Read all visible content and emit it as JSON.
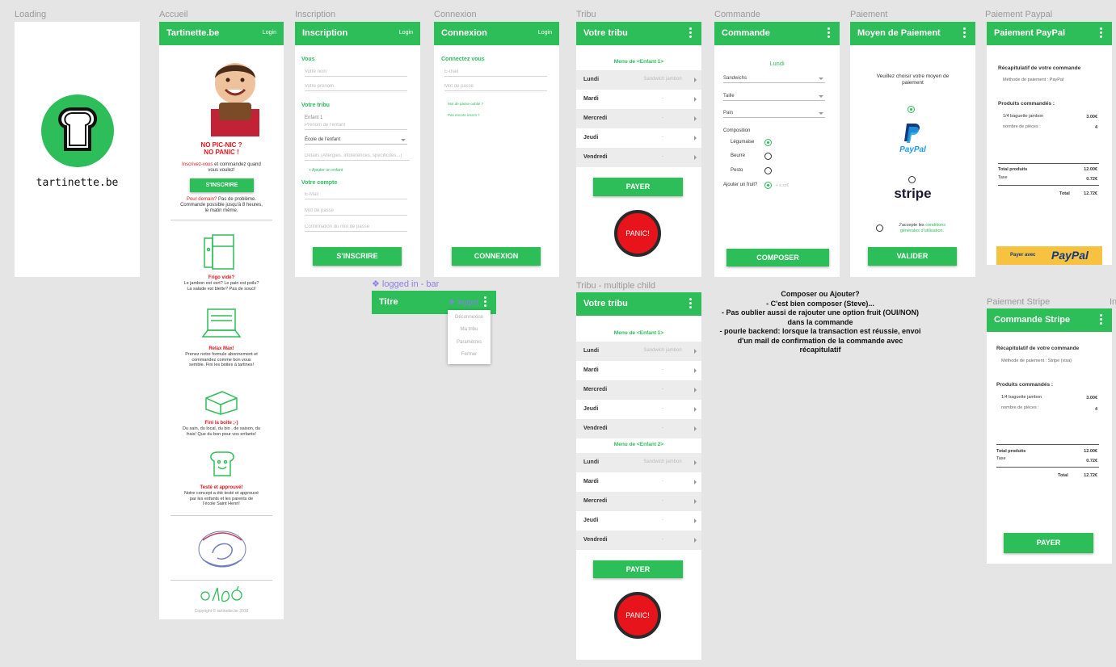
{
  "frame_labels": {
    "loading": "Loading",
    "accueil": "Accueil",
    "inscription": "Inscription",
    "connexion": "Connexion",
    "tribu": "Tribu",
    "commande": "Commande",
    "paiement": "Paiement",
    "paiement_paypal": "Paiement Paypal",
    "tribu_multi": "Tribu - multiple child",
    "paiement_stripe": "Paiement Stripe",
    "logged_in_bar": "❖ logged in - bar",
    "cut_off": "In"
  },
  "loading": {
    "brand": "tartinette.be"
  },
  "accueil": {
    "title": "Tartinette.be",
    "login": "Login",
    "headline1": "NO PIC-NIC ?",
    "headline2": "NO PANIC !",
    "cta_text_link": "Inscrivez-vous",
    "cta_text_rest": " et commandez quand",
    "cta_text2": "vous voulez!",
    "signup_button": "S'INSCRIRE",
    "tomorrow_red": "Pour demain?",
    "tomorrow_rest": " Pas de problème.",
    "tomorrow2": "Commande possible jusqu'à 8 heures,",
    "tomorrow3": "le matin même.",
    "features": [
      {
        "title": "Frigo vide?",
        "l1": "Le jambon est vert? Le pain est poilu?",
        "l2": "La salade est blette? Pas de souci!",
        "l3": ""
      },
      {
        "title": "Relax Max!",
        "l1": "Prenez notre formule abonnement et",
        "l2": "commandez comme bon vous",
        "l3": "semble. Fini les boites à tartines!"
      },
      {
        "title": "Fini la boite ;-)",
        "l1": "Du sain, du local, du bio , de saison, du",
        "l2": "frais! Que du bon pour vos enfants!",
        "l3": ""
      },
      {
        "title": "Testé et approuvé!",
        "l1": "Notre concept a été testé et approuvé",
        "l2": "par les enfants et les parents de",
        "l3": "l'école Saint Henri!"
      }
    ],
    "copyright": "Copyright © tartinette.be 2018"
  },
  "inscription": {
    "title": "Inscription",
    "login": "Login",
    "vous": "Vous",
    "nom_ph": "Votre nom",
    "prenom_ph": "Votre prénom",
    "tribu": "Votre tribu",
    "enfant": "Enfant 1",
    "prenom_enfant_ph": "Prénom de l'enfant",
    "ecole": "École de l'enfant",
    "details_ph": "Détails (Allergies, intolérences, spécificités...)",
    "add_child": "+ Ajouter un enfant",
    "compte": "Votre compte",
    "email_ph": "E-Mail",
    "password_ph": "Mot de passe",
    "confirm_ph": "Confirmation du mot de passe",
    "button": "S'INSCRIRE"
  },
  "connexion": {
    "title": "Connexion",
    "login": "Login",
    "subtitle": "Connectez vous",
    "email_ph": "E-mail",
    "password_ph": "Mot de passe",
    "forgot": "Mot de passe oublié ?",
    "not_registered": "Pas encore inscrit ?",
    "button": "CONNEXION"
  },
  "logged_bar": {
    "title": "Titre",
    "logged": "❖ logged",
    "menu": [
      "Déconnexion",
      "Ma tribu",
      "Paramètres",
      "Fermer"
    ]
  },
  "tribu": {
    "title": "Votre tribu",
    "menu_label": "Menu de <Enfant 1>",
    "days": [
      {
        "day": "Lundi",
        "value": "Sandwich jambon"
      },
      {
        "day": "Mardi",
        "value": "-"
      },
      {
        "day": "Mercredi",
        "value": "-"
      },
      {
        "day": "Jeudi",
        "value": "-"
      },
      {
        "day": "Vendredi",
        "value": "-"
      }
    ],
    "pay_button": "PAYER",
    "panic": "PANIC!"
  },
  "tribu_multi": {
    "title": "Votre tribu",
    "menu1": "Menu de <Enfant 1>",
    "menu2": "Menu de <Enfant 2>",
    "days1": [
      {
        "day": "Lundi",
        "value": "Sandwich jambon"
      },
      {
        "day": "Mardi",
        "value": "-"
      },
      {
        "day": "Mercredi",
        "value": "-"
      },
      {
        "day": "Jeudi",
        "value": "-"
      },
      {
        "day": "Vendredi",
        "value": "-"
      }
    ],
    "days2": [
      {
        "day": "Lundi",
        "value": "Sandwich jambon"
      },
      {
        "day": "Mardi",
        "value": "-"
      },
      {
        "day": "Mercredi",
        "value": "-"
      },
      {
        "day": "Jeudi",
        "value": "-"
      },
      {
        "day": "Vendredi",
        "value": "-"
      }
    ],
    "pay_button": "PAYER",
    "panic": "PANIC!"
  },
  "commande": {
    "title": "Commande",
    "day": "Lundi",
    "sandwich": "Sandwichs",
    "taille": "Taille",
    "pain": "Pain",
    "composition": "Composition",
    "options": [
      "Légumaise",
      "Beurre",
      "Pesto"
    ],
    "fruit_label": "Ajouter un fruit?",
    "fruit_extra": "+ x.xx€",
    "button": "COMPOSER"
  },
  "paiement": {
    "title": "Moyen de Paiement",
    "prompt1": "Veuillez choisir votre moyen de",
    "prompt2": "paiement",
    "paypal": "PayPal",
    "stripe": "stripe",
    "terms_pre": "J'accepte les ",
    "terms_link1": "conditions",
    "terms_link2": "générales d'utilisation.",
    "button": "VALIDER"
  },
  "paypal": {
    "title": "Paiement PayPal",
    "recap": "Récapitulatif de votre commande",
    "method": "Méthode de paiement : PayPal",
    "products": "Produits commandés :",
    "item": "1/4 baguette jambon",
    "item_price": "3.00€",
    "pieces_label": "nombre de pièces :",
    "pieces": "4",
    "total_label": "Total produits",
    "total": "12.00€",
    "tax_label": "Taxe",
    "tax": "0.72€",
    "grand_label": "Total",
    "grand": "12.72€",
    "pay_with": "Payer avec",
    "pay_brand": "PayPal"
  },
  "stripe": {
    "title": "Commande Stripe",
    "recap": "Récapitulatif de votre commande",
    "method": "Méthode de paiement : Stripe (visa)",
    "products": "Produits commandés :",
    "item": "1/4 baguette jambon",
    "item_price": "3.00€",
    "pieces_label": "nombre de pièces :",
    "pieces": "4",
    "total_label": "Total produits",
    "total": "12.00€",
    "tax_label": "Taxe",
    "tax": "0.72€",
    "grand_label": "Total",
    "grand": "12.72€",
    "button": "PAYER"
  },
  "note": [
    "Composer ou Ajouter?",
    "- C'est bien composer (Steve)...",
    "- Pas oublier aussi de rajouter une option fruit (OUI/NON)",
    "dans la commande",
    "- pourle backend: lorsque la transaction est réussie, envoi",
    "d'un mail de confirmation de la commande avec",
    "récapitulatif"
  ],
  "colors": {
    "green": "#2dbd59",
    "red": "#e8141c",
    "paypal_yellow": "#f6c23f"
  }
}
